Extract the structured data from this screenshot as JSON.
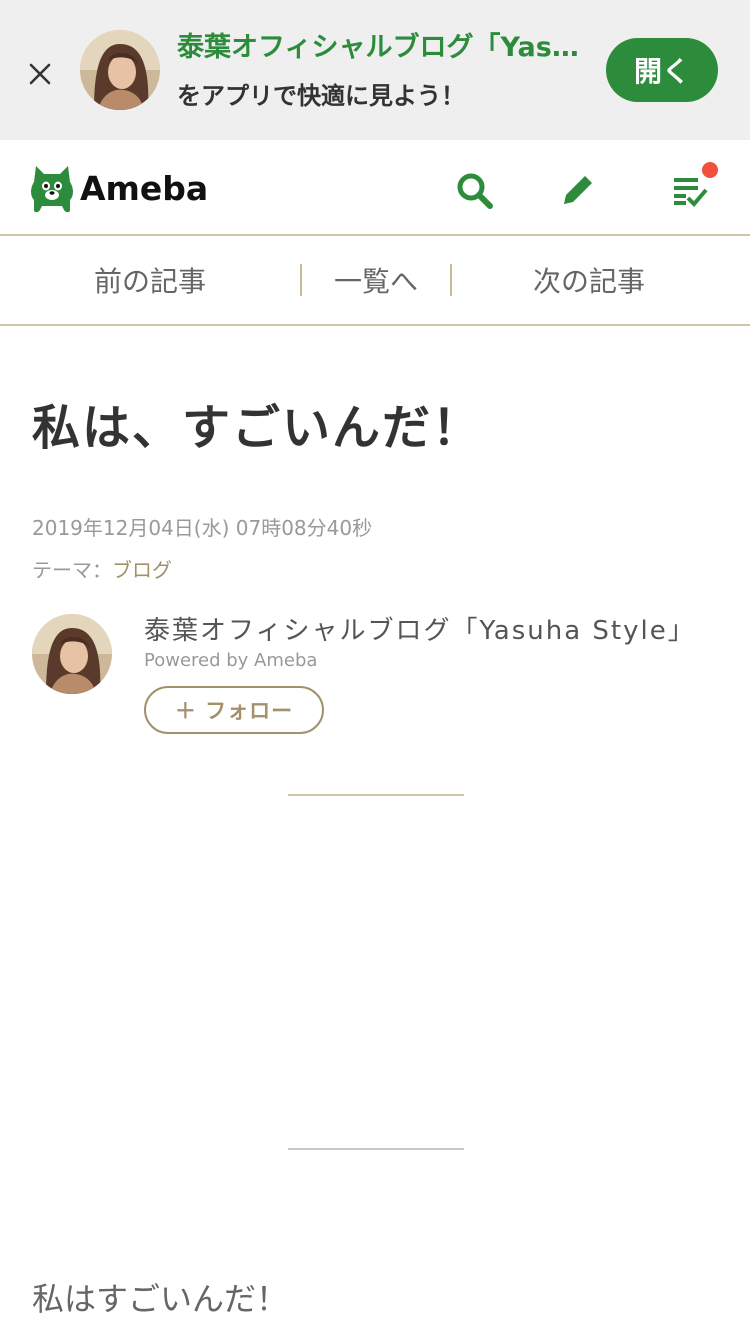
{
  "app_banner": {
    "title": "泰葉オフィシャルブログ「Yasuha Style」",
    "subtitle": "をアプリで快適に見よう！",
    "open_label": "開く",
    "close_icon": "close-icon"
  },
  "header": {
    "logo_text": "Ameba",
    "icons": [
      "search-icon",
      "pencil-icon",
      "checklist-icon"
    ],
    "accent_color": "#2d8c3c",
    "notification_color": "#f0503c"
  },
  "article_nav": {
    "prev": "前の記事",
    "list": "一覧へ",
    "next": "次の記事"
  },
  "entry": {
    "title": "私は、すごいんだ！",
    "date": "2019年12月04日(水) 07時08分40秒",
    "theme_label": "テーマ：",
    "theme": "ブログ",
    "body": "私はすごいんだ！"
  },
  "author": {
    "blog_name": "泰葉オフィシャルブログ「Yasuha Style」",
    "powered_by": "Powered by Ameba",
    "follow_label": "＋ フォロー"
  }
}
